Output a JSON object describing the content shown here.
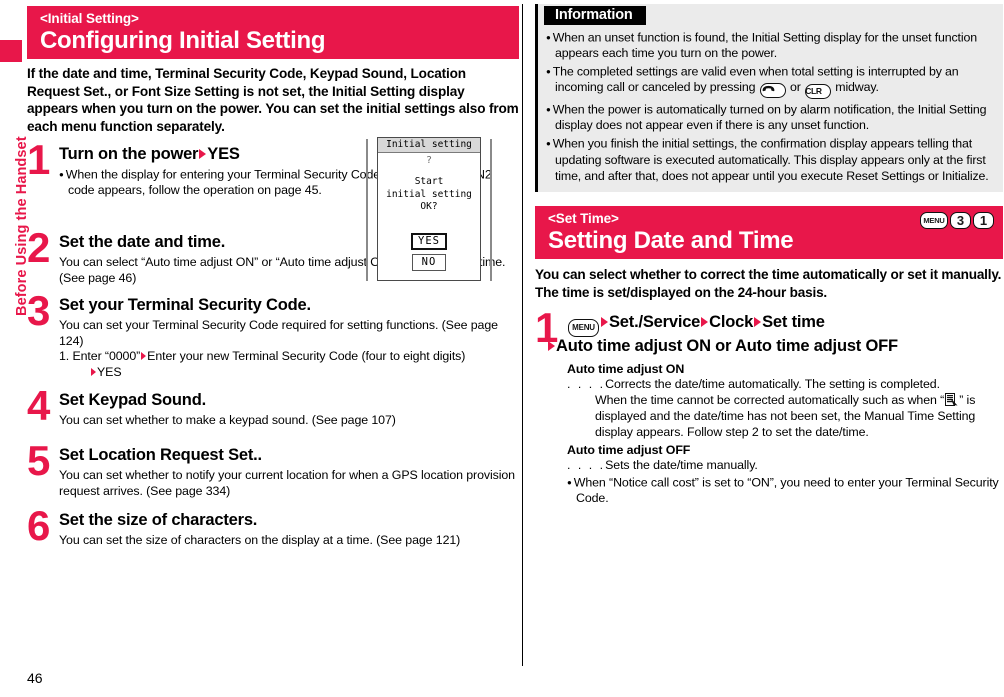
{
  "page": {
    "number": "46",
    "side_tab_label": "Before Using the Handset",
    "accent_color": "#E8174A"
  },
  "left_column": {
    "header": {
      "subtitle": "<Initial Setting>",
      "title": "Configuring Initial Setting"
    },
    "intro": "If the date and time, Terminal Security Code, Keypad Sound, Location Request Set., or Font Size Setting is not set, the Initial Setting display appears when you turn on the power. You can set the initial settings also from each menu function separately.",
    "steps": [
      {
        "num": "1",
        "title_a": "Turn on the power",
        "title_b": "YES",
        "bullet": "When the display for entering your Terminal Security Code, PIN1 code, or PIN2 code appears, follow the operation on page 45."
      },
      {
        "num": "2",
        "title": "Set the date and time.",
        "body": "You can select “Auto time adjust ON” or “Auto time adjust OFF” for setting the time. (See page 46)"
      },
      {
        "num": "3",
        "title": "Set your Terminal Security Code.",
        "body": "You can set your Terminal Security Code required for setting functions. (See page 124)",
        "sub_a": "1. Enter “0000”",
        "sub_b": "Enter your new Terminal Security Code (four to eight digits)",
        "sub_c": "YES"
      },
      {
        "num": "4",
        "title": "Set Keypad Sound.",
        "body": "You can set whether to make a keypad sound. (See page 107)"
      },
      {
        "num": "5",
        "title": "Set Location Request Set..",
        "body": "You can set whether to notify your current location for when a GPS location provision request arrives. (See page 334)"
      },
      {
        "num": "6",
        "title": "Set the size of characters.",
        "body": "You can set the size of characters on the display at a time. (See page 121)"
      }
    ],
    "phone_mockup": {
      "title": "Initial setting",
      "qmark": "?",
      "message_line1": "Start",
      "message_line2": "initial setting",
      "message_line3": "OK?",
      "yes_label": "YES",
      "no_label": "NO"
    }
  },
  "right_column": {
    "info_box": {
      "title": "Information",
      "items": [
        {
          "text": "When an unset function is found, the Initial Setting display for the unset function appears each time you turn on the power."
        },
        {
          "text_a": "The completed settings are valid even when total setting is interrupted by an incoming call or canceled by pressing ",
          "key1": "end-call-key",
          "text_b": " or ",
          "key2": "CLR",
          "text_c": " midway."
        },
        {
          "text": "When the power is automatically turned on by alarm notification, the Initial Setting display does not appear even if there is any unset function."
        },
        {
          "text": "When you finish the initial settings, the confirmation display appears telling that updating software is executed automatically. This display appears only at the first time, and after that, does not appear until you execute Reset Settings or Initialize."
        }
      ]
    },
    "header": {
      "subtitle": "<Set Time>",
      "title": "Setting Date and Time",
      "key_sequence": [
        "MENU",
        "3",
        "1"
      ]
    },
    "intro": "You can select whether to correct the time automatically or set it manually. The time is set/displayed on the 24-hour basis.",
    "step": {
      "num": "1",
      "key": "MENU",
      "path_1": "Set./Service",
      "path_2": "Clock",
      "path_3": "Set time",
      "path_4": "Auto time adjust ON or Auto time adjust OFF",
      "on_heading": "Auto time adjust ON",
      "on_dots": ". . . .",
      "on_line1": "Corrects the date/time automatically. The setting is completed.",
      "on_line2_a": "When the time cannot be corrected automatically such as when “",
      "on_line2_b": "” is displayed and the date/time has not been set, the Manual Time Setting display appears. Follow step 2 to set the date/time.",
      "off_heading": "Auto time adjust OFF",
      "off_dots": ". . . .",
      "off_line1": "Sets the date/time manually.",
      "note": "When “Notice call cost” is set to “ON”, you need to enter your Terminal Security Code."
    }
  }
}
